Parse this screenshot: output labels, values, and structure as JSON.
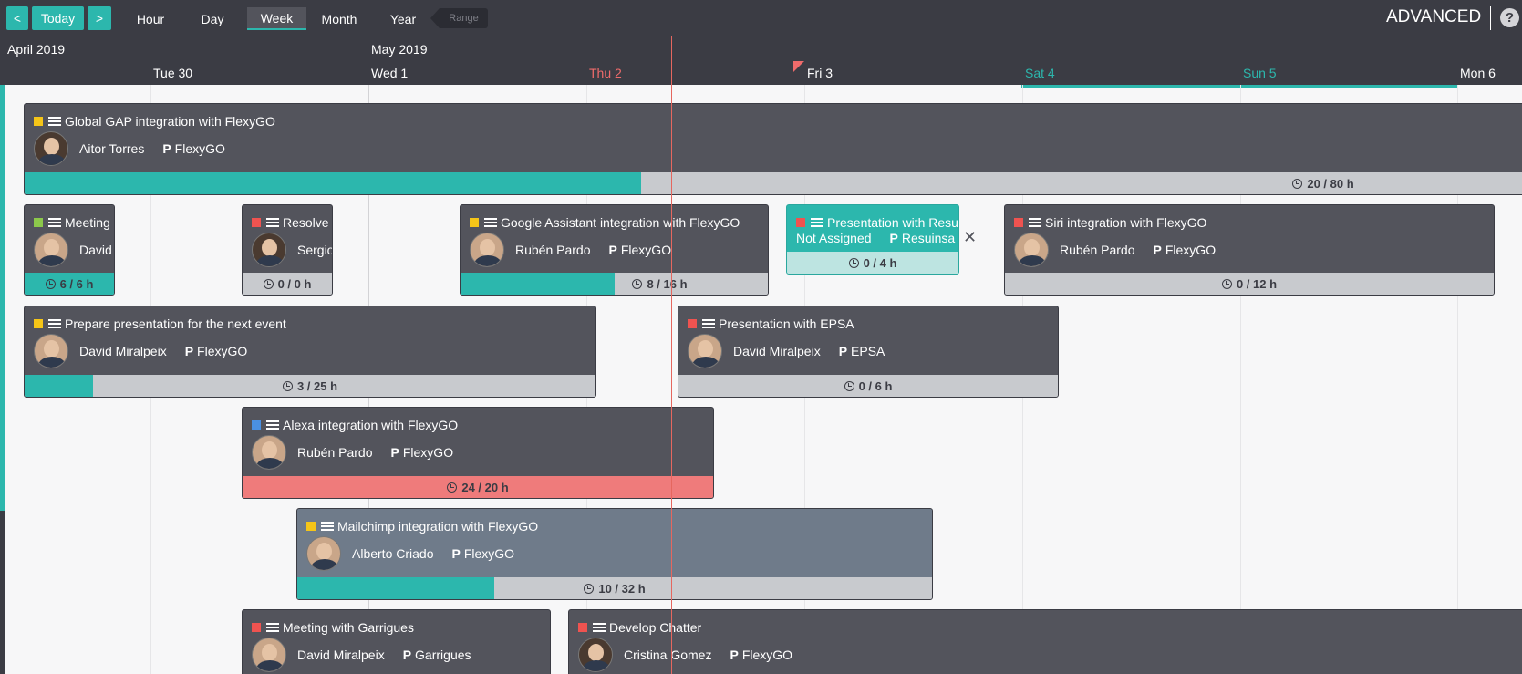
{
  "toolbar": {
    "prev": "<",
    "today": "Today",
    "next": ">",
    "views": [
      "Hour",
      "Day",
      "Week",
      "Month",
      "Year"
    ],
    "active_view": "Week",
    "range": "Range",
    "mode": "ADVANCED",
    "help": "?"
  },
  "timeline": {
    "months": [
      "April 2019",
      "May 2019"
    ],
    "days": [
      "Tue 30",
      "Wed 1",
      "Thu 2",
      "Fri 3",
      "Sat 4",
      "Sun 5",
      "Mon 6"
    ]
  },
  "tasks": [
    {
      "title": "Global GAP integration with FlexyGO",
      "user": "Aitor Torres",
      "project": "FlexyGO",
      "progress": "20 / 80 h",
      "fraction": 0.41,
      "dot_color": "#f5c518"
    },
    {
      "title": "Meeting",
      "user": "David",
      "project": "",
      "progress": "6 / 6 h",
      "fraction": 1.0,
      "dot_color": "#8cc84b"
    },
    {
      "title": "Resolve",
      "user": "Sergio",
      "project": "",
      "progress": "0 / 0 h",
      "fraction": 0.0,
      "dot_color": "#ef5350"
    },
    {
      "title": "Google Assistant integration with FlexyGO",
      "user": "Rubén Pardo",
      "project": "FlexyGO",
      "progress": "8 / 16 h",
      "fraction": 0.5,
      "dot_color": "#f5c518"
    },
    {
      "title": "Presentation with Resu",
      "user": "Not Assigned",
      "project": "Resuinsa",
      "progress": "0 / 4 h",
      "fraction": 0.0,
      "dot_color": "#ef5350"
    },
    {
      "title": "Siri integration with FlexyGO",
      "user": "Rubén Pardo",
      "project": "FlexyGO",
      "progress": "0 / 12 h",
      "fraction": 0.0,
      "dot_color": "#ef5350"
    },
    {
      "title": "Prepare presentation for the next event",
      "user": "David Miralpeix",
      "project": "FlexyGO",
      "progress": "3 / 25 h",
      "fraction": 0.12,
      "dot_color": "#f5c518"
    },
    {
      "title": "Presentation with EPSA",
      "user": "David Miralpeix",
      "project": "EPSA",
      "progress": "0 / 6 h",
      "fraction": 0.0,
      "dot_color": "#ef5350"
    },
    {
      "title": "Alexa integration with FlexyGO",
      "user": "Rubén Pardo",
      "project": "FlexyGO",
      "progress": "24 / 20 h",
      "fraction": 1.2,
      "dot_color": "#4a90e2"
    },
    {
      "title": "Mailchimp integration with FlexyGO",
      "user": "Alberto Criado",
      "project": "FlexyGO",
      "progress": "10 / 32 h",
      "fraction": 0.31,
      "dot_color": "#f5c518"
    },
    {
      "title": "Meeting with Garrigues",
      "user": "David Miralpeix",
      "project": "Garrigues",
      "progress": "",
      "fraction": 0.0,
      "dot_color": "#ef5350"
    },
    {
      "title": "Develop Chatter",
      "user": "Cristina Gomez",
      "project": "FlexyGO",
      "progress": "",
      "fraction": 0.0,
      "dot_color": "#ef5350"
    }
  ],
  "colors": {
    "accent": "#2cb7ad",
    "header": "#3b3c44",
    "card": "#53545c",
    "over": "#ef7b7b",
    "today_line": "#e5675f"
  },
  "icons": [
    "chevron-left-icon",
    "chevron-right-icon",
    "list-icon",
    "project-p-icon",
    "clock-icon",
    "close-icon",
    "help-icon"
  ]
}
